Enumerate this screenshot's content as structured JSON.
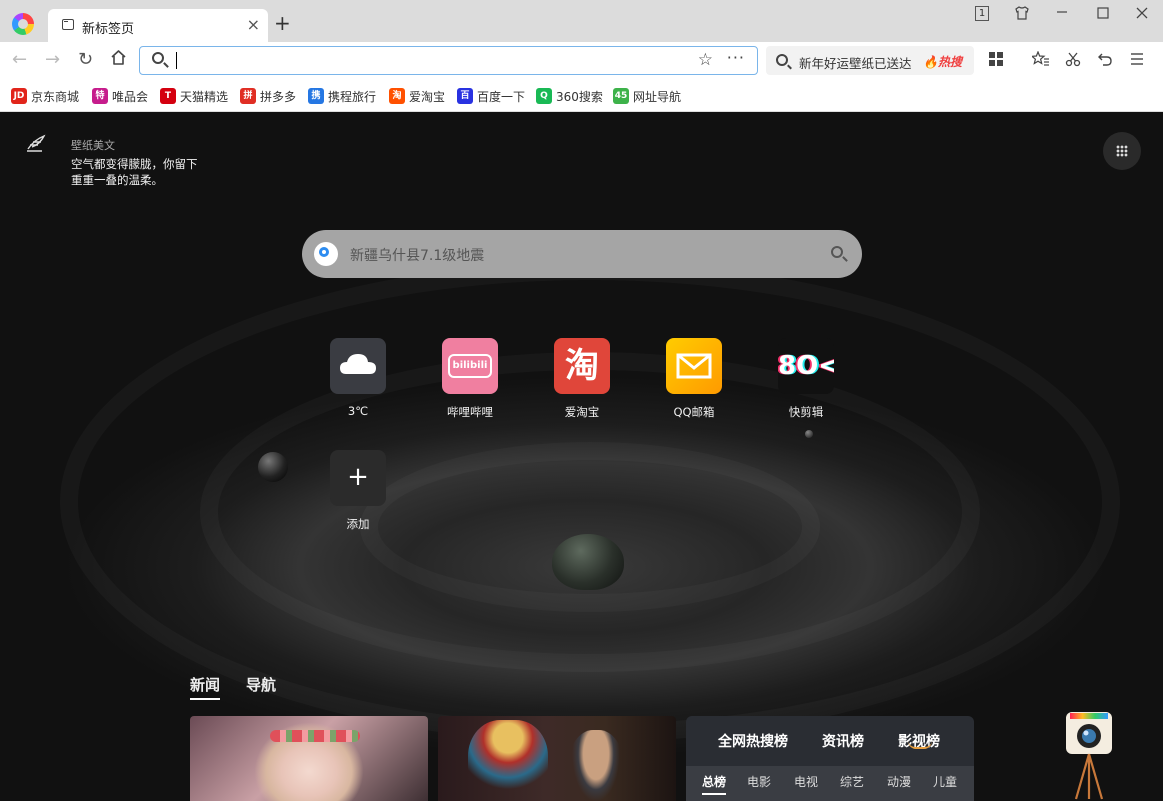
{
  "tabstrip": {
    "tab_title": "新标签页",
    "close_glyph": "×",
    "new_tab_glyph": "+",
    "tab_count_badge": "1"
  },
  "toolbar": {
    "back_glyph": "←",
    "forward_glyph": "→",
    "reload_glyph": "↻",
    "home_glyph": "⌂",
    "address_value": "",
    "star_glyph": "☆",
    "more_glyph": "···",
    "hot_search_text": "新年好运壁纸已送达",
    "hot_search_badge": "热搜"
  },
  "bookmarks": [
    {
      "label": "京东商城",
      "icon": "jd-icon",
      "color": "#e1251b",
      "glyph": "JD"
    },
    {
      "label": "唯品会",
      "icon": "vip-icon",
      "color": "#c61c8c",
      "glyph": "特"
    },
    {
      "label": "天猫精选",
      "icon": "tmall-icon",
      "color": "#d4000f",
      "glyph": "T"
    },
    {
      "label": "拼多多",
      "icon": "pdd-icon",
      "color": "#e02e24",
      "glyph": "拼"
    },
    {
      "label": "携程旅行",
      "icon": "ctrip-icon",
      "color": "#2577e3",
      "glyph": "携"
    },
    {
      "label": "爱淘宝",
      "icon": "taobao-icon",
      "color": "#ff5000",
      "glyph": "淘"
    },
    {
      "label": "百度一下",
      "icon": "baidu-icon",
      "color": "#2932e1",
      "glyph": "百"
    },
    {
      "label": "360搜索",
      "icon": "so360-icon",
      "color": "#19b955",
      "glyph": "Q"
    },
    {
      "label": "网址导航",
      "icon": "nav2345-icon",
      "color": "#3db24a",
      "glyph": "45"
    }
  ],
  "wallpaper": {
    "label": "壁纸美文",
    "text_line1": "空气都变得朦胧，你留下",
    "text_line2": "重重一叠的温柔。"
  },
  "search": {
    "placeholder": "新疆乌什县7.1级地震"
  },
  "tiles": [
    {
      "label": "3℃",
      "icon": "cloud-icon"
    },
    {
      "label": "哔哩哔哩",
      "icon": "bilibili-icon"
    },
    {
      "label": "爱淘宝",
      "icon": "taobao-icon"
    },
    {
      "label": "QQ邮箱",
      "icon": "qqmail-icon"
    },
    {
      "label": "快剪辑",
      "icon": "kuaijianji-icon"
    },
    {
      "label": "添加",
      "icon": "plus-icon"
    }
  ],
  "tile_glyphs": {
    "bilibili": "bilibili",
    "taobao": "淘",
    "kuaijianji": "8O<",
    "add": "+"
  },
  "news": {
    "tabs": [
      "新闻",
      "导航"
    ],
    "active_tab": "新闻"
  },
  "ranking": {
    "tabs": [
      "全网热搜榜",
      "资讯榜",
      "影视榜"
    ],
    "active_tab": "影视榜",
    "subtabs": [
      "总榜",
      "电影",
      "电视",
      "综艺",
      "动漫",
      "儿童"
    ],
    "active_subtab": "总榜"
  },
  "colors": {
    "accent": "#2d8cf0",
    "hot": "#f04040"
  }
}
